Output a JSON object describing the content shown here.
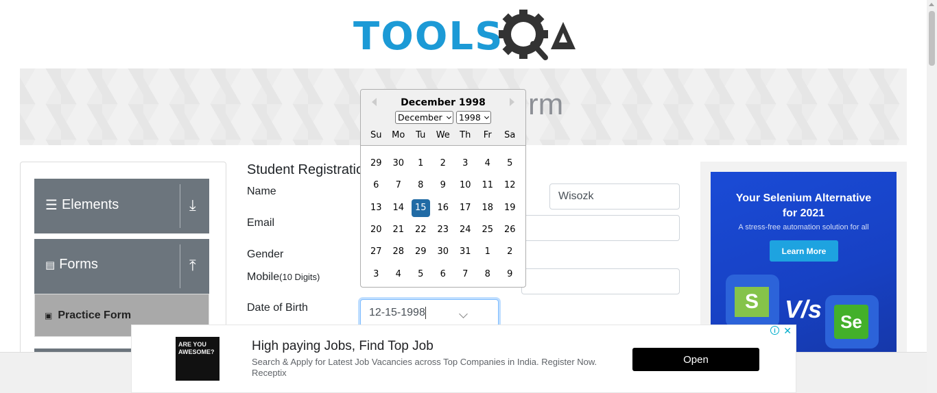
{
  "header": {
    "logo_text": "TOOLS",
    "logo_suffix": "A"
  },
  "banner": {
    "title": "rm"
  },
  "sidebar": {
    "groups": [
      {
        "label": "Elements",
        "arrow": "⤓"
      },
      {
        "label": "Forms",
        "arrow": "⤒"
      }
    ],
    "active_item": "Practice Form"
  },
  "form": {
    "title": "Student Registratio",
    "labels": {
      "name": "Name",
      "email": "Email",
      "gender": "Gender",
      "mobile": "Mobile",
      "mobile_hint": "(10 Digits)",
      "dob": "Date of Birth"
    },
    "last_name_value": "Wisozk",
    "dob_value": "12-15-1998"
  },
  "datepicker": {
    "title": "December 1998",
    "month_select": "December",
    "year_select": "1998",
    "day_names": [
      "Su",
      "Mo",
      "Tu",
      "We",
      "Th",
      "Fr",
      "Sa"
    ],
    "weeks": [
      [
        "29",
        "30",
        "1",
        "2",
        "3",
        "4",
        "5"
      ],
      [
        "6",
        "7",
        "8",
        "9",
        "10",
        "11",
        "12"
      ],
      [
        "13",
        "14",
        "15",
        "16",
        "17",
        "18",
        "19"
      ],
      [
        "20",
        "21",
        "22",
        "23",
        "24",
        "25",
        "26"
      ],
      [
        "27",
        "28",
        "29",
        "30",
        "31",
        "1",
        "2"
      ],
      [
        "3",
        "4",
        "5",
        "6",
        "7",
        "8",
        "9"
      ]
    ],
    "selected": "15"
  },
  "right_ad": {
    "headline_1": "Your Selenium Alternative",
    "headline_2": "for 2021",
    "sub": "A stress-free automation solution for all",
    "button": "Learn More",
    "left_logo": "S",
    "vs": "V/s",
    "right_logo": "Se"
  },
  "bottom_ad": {
    "thumb_text": "ARE YOU AWESOME?",
    "title": "High paying Jobs, Find Top Job",
    "description": "Search & Apply for Latest Job Vacancies across Top Companies in India. Register Now.",
    "advertiser": "Receptix",
    "cta": "Open"
  },
  "colors": {
    "brand": "#1c9ad6",
    "sidebar": "#6c757d",
    "selected_day": "#216ba5"
  }
}
